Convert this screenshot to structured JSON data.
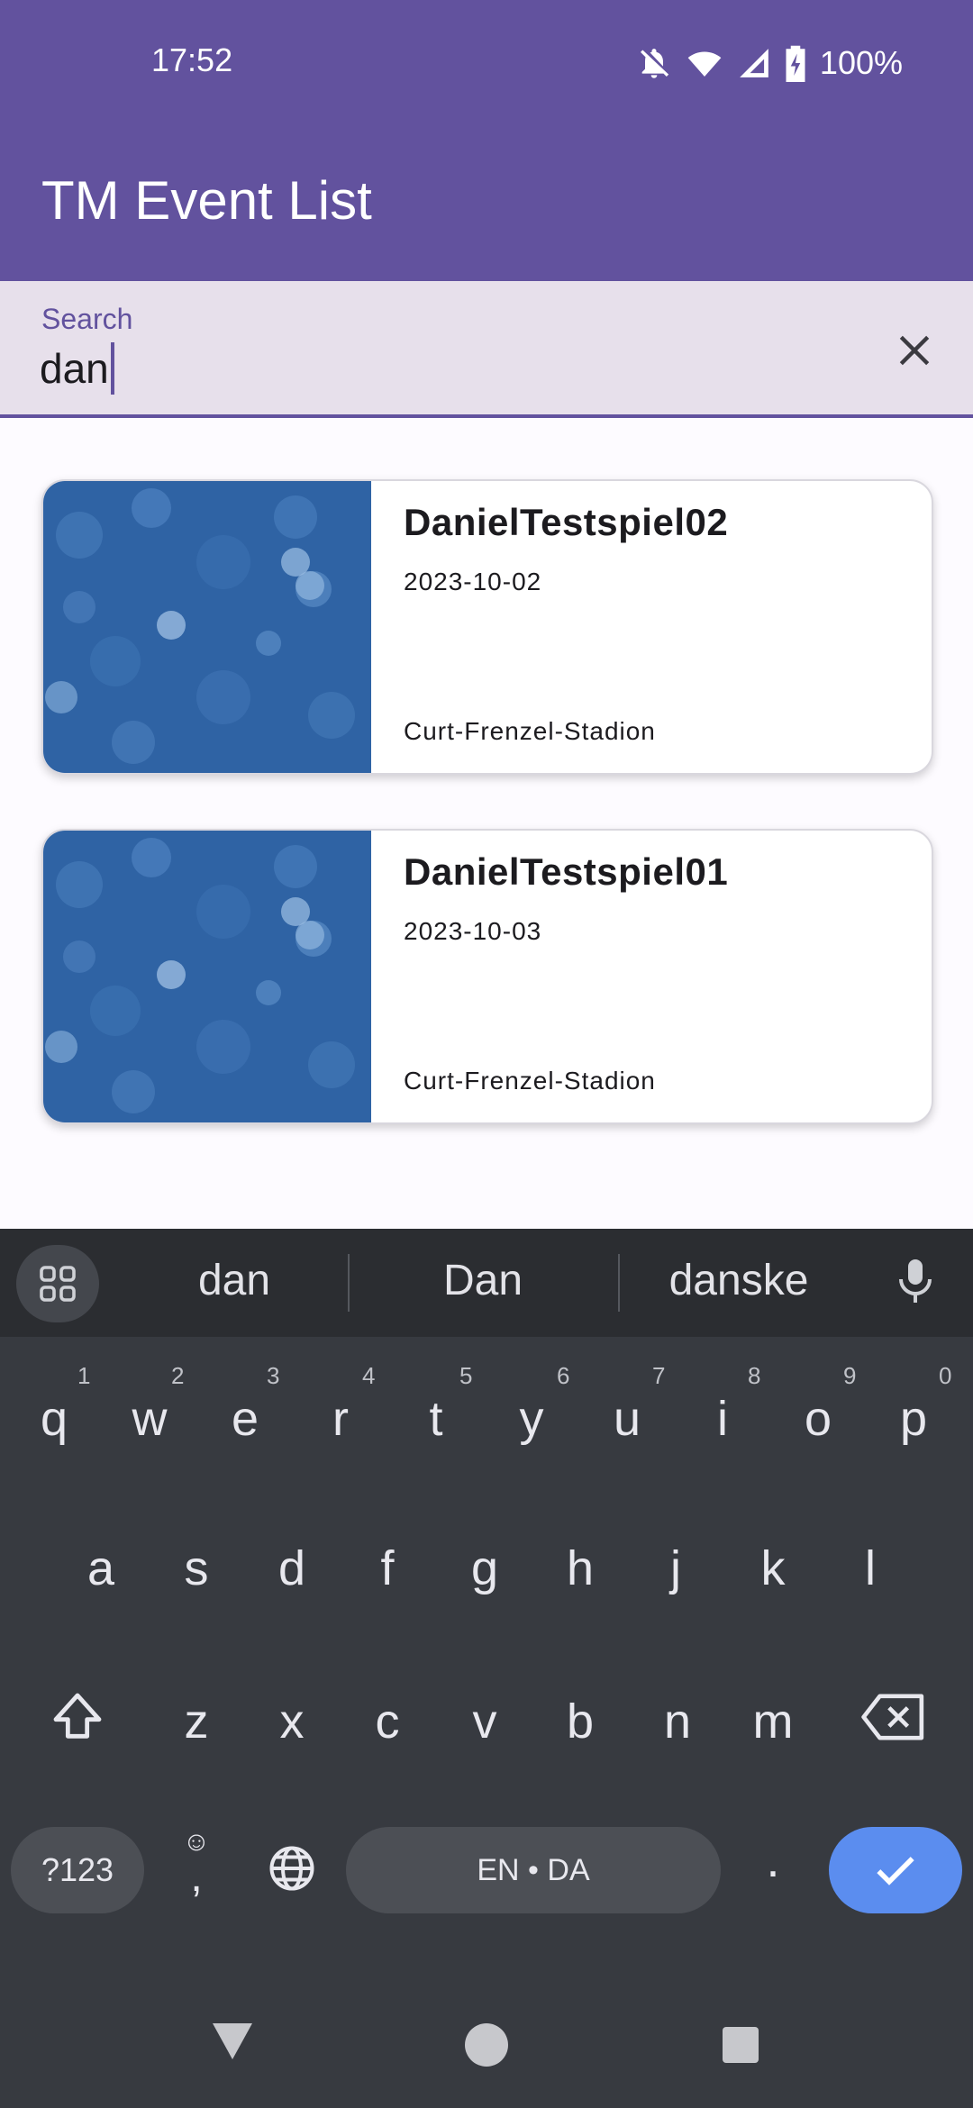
{
  "status_bar": {
    "time": "17:52",
    "battery": "100%"
  },
  "app": {
    "title": "TM Event List"
  },
  "search": {
    "label": "Search",
    "value": "dan"
  },
  "events": [
    {
      "title": "DanielTestspiel02",
      "date": "2023-10-02",
      "venue": "Curt-Frenzel-Stadion"
    },
    {
      "title": "DanielTestspiel01",
      "date": "2023-10-03",
      "venue": "Curt-Frenzel-Stadion"
    }
  ],
  "keyboard": {
    "suggestions": [
      "dan",
      "Dan",
      "danske"
    ],
    "row1": [
      "q",
      "w",
      "e",
      "r",
      "t",
      "y",
      "u",
      "i",
      "o",
      "p"
    ],
    "row1_hints": [
      "1",
      "2",
      "3",
      "4",
      "5",
      "6",
      "7",
      "8",
      "9",
      "0"
    ],
    "row2": [
      "a",
      "s",
      "d",
      "f",
      "g",
      "h",
      "j",
      "k",
      "l"
    ],
    "row3": [
      "z",
      "x",
      "c",
      "v",
      "b",
      "n",
      "m"
    ],
    "symbols_key": "?123",
    "comma_key": ",",
    "space_label": "EN • DA",
    "period_key": "."
  },
  "colors": {
    "primary": "#62529e",
    "enter_key": "#5b8def"
  }
}
